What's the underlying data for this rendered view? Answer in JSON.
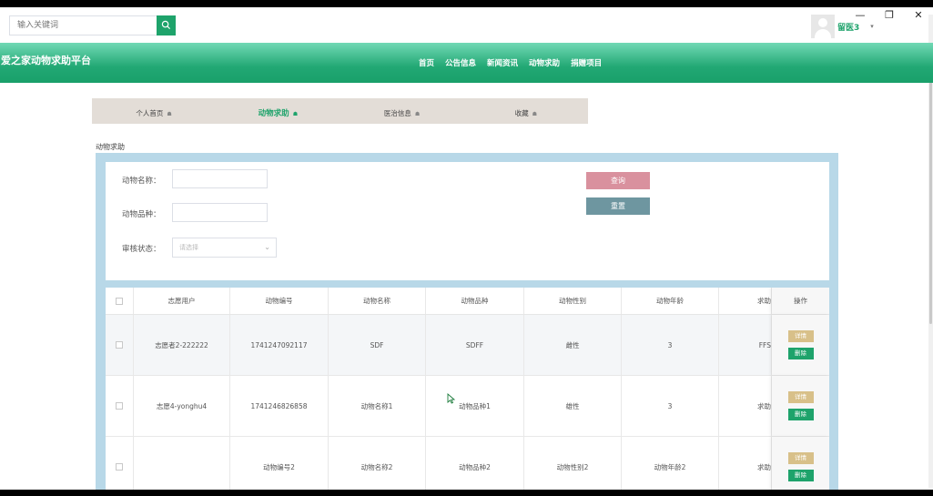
{
  "window": {
    "minimize": "—",
    "restore": "❐",
    "close": "✕"
  },
  "search": {
    "placeholder": "输入关键词"
  },
  "user": {
    "name": "留医3",
    "caret": "▾"
  },
  "header": {
    "site_title": "爱之家动物求助平台",
    "nav": [
      "首页",
      "公告信息",
      "新闻资讯",
      "动物求助",
      "捐赠项目"
    ]
  },
  "tabs": [
    {
      "label": "个人首页",
      "icon": "☗"
    },
    {
      "label": "动物求助",
      "icon": "☗"
    },
    {
      "label": "医治信息",
      "icon": "☗"
    },
    {
      "label": "收藏",
      "icon": "☗"
    }
  ],
  "section_label": "动物求助",
  "form": {
    "name_label": "动物名称：",
    "breed_label": "动物品种：",
    "status_label": "审核状态：",
    "status_placeholder": "请选择",
    "query_button": "查询",
    "reset_button": "重置"
  },
  "table": {
    "headers": [
      "志愿用户",
      "动物编号",
      "动物名称",
      "动物品种",
      "动物性别",
      "动物年龄",
      "求助",
      "操作"
    ],
    "rows": [
      [
        "志愿者2-222222",
        "1741247092117",
        "SDF",
        "SDFF",
        "雌性",
        "3",
        "FFS"
      ],
      [
        "志愿4-yonghu4",
        "1741246826858",
        "动物名称1",
        "动物品种1",
        "雄性",
        "3",
        "求助"
      ],
      [
        "",
        "动物编号2",
        "动物名称2",
        "动物品种2",
        "动物性别2",
        "动物年龄2",
        "求助"
      ]
    ],
    "detail_button": "详情",
    "delete_button": "删除"
  }
}
